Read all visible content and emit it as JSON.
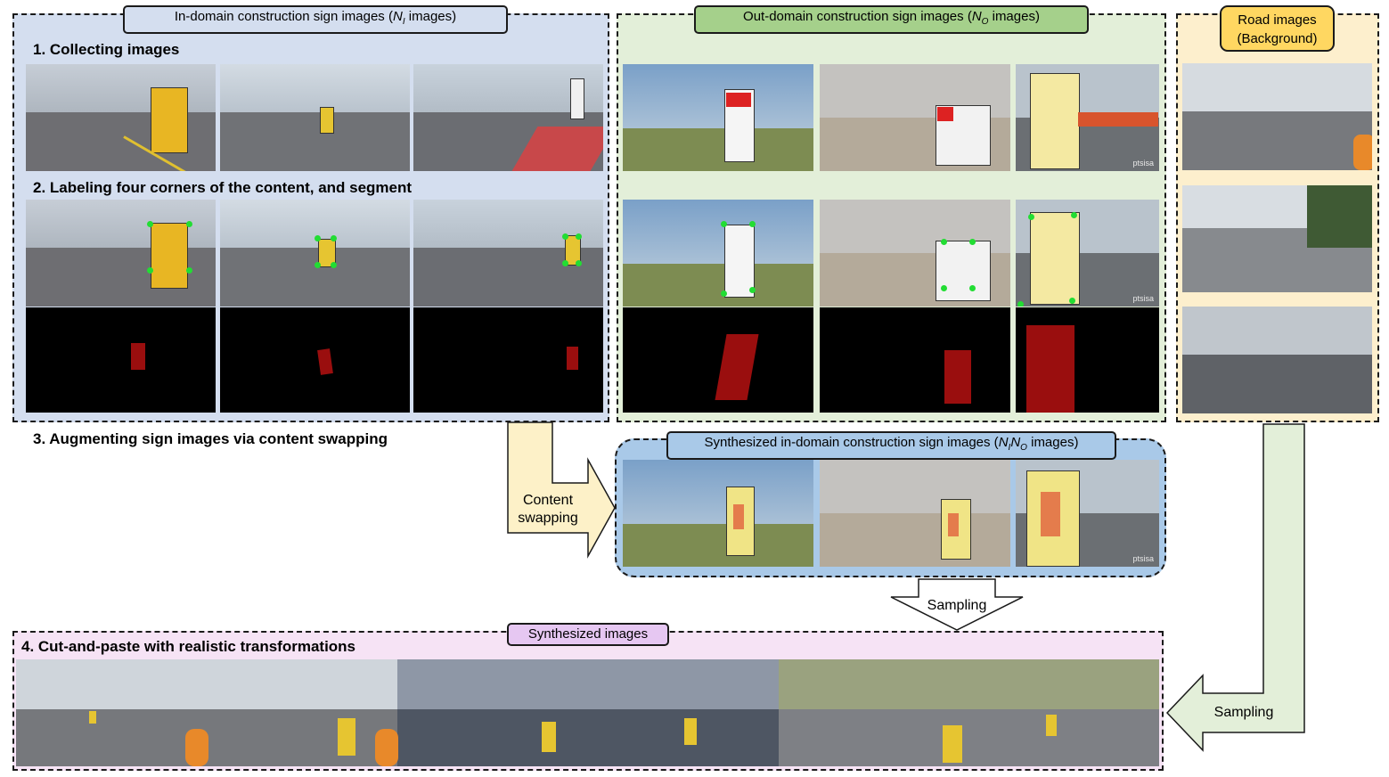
{
  "panels": {
    "in_domain": {
      "title": "In-domain construction sign images (",
      "symbol": "N",
      "sub": "I",
      "suffix": " images)"
    },
    "out_domain": {
      "title": "Out-domain construction sign images (",
      "symbol": "N",
      "sub": "O",
      "suffix": " images)"
    },
    "road": {
      "title_line1": "Road images",
      "title_line2": "(Background)"
    },
    "synth_in": {
      "title": "Synthesized in-domain construction sign images (",
      "symbol1": "N",
      "sub1": "I",
      "symbol2": "N",
      "sub2": "O",
      "suffix": " images)"
    },
    "synth_out": {
      "title": "Synthesized images"
    }
  },
  "steps": {
    "step1": "1. Collecting images",
    "step2": "2. Labeling four corners of the content, and segment",
    "step3": "3. Augmenting sign images via content swapping",
    "step4": "4. Cut-and-paste with realistic transformations"
  },
  "arrows": {
    "content_swap_line1": "Content",
    "content_swap_line2": "swapping",
    "sampling_down": "Sampling",
    "sampling_right": "Sampling"
  },
  "photo_text": {
    "watermark": "ptsisa"
  },
  "colors": {
    "blue_panel": "#d4deef",
    "green_panel": "#e3efd9",
    "yellow_panel": "#fdefcd",
    "pink_panel": "#f6e3f5",
    "synth_blue": "#a9c9e8",
    "green_label": "#a5d08b",
    "yellow_label": "#ffd761",
    "purple_label": "#e6c7f2",
    "arrow_yellow": "#fdf1c8",
    "arrow_green": "#e3efd9"
  }
}
